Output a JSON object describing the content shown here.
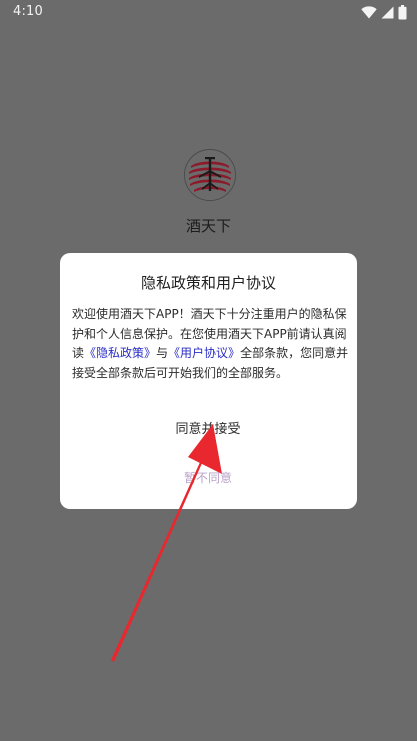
{
  "status_bar": {
    "time": "4:10",
    "icons": [
      "wifi-icon",
      "signal-icon",
      "battery-icon"
    ]
  },
  "app": {
    "name": "酒天下",
    "logo_icon": "jiutianxia-logo-icon"
  },
  "dialog": {
    "title": "隐私政策和用户协议",
    "body": {
      "text_before": "欢迎使用酒天下APP！酒天下十分注重用户的隐私保护和个人信息保护。在您使用酒天下APP前请认真阅读",
      "privacy_link": "《隐私政策》",
      "and_text": "与",
      "agreement_link": "《用户协议》",
      "text_after": "全部条款，您同意并接受全部条款后可开始我们的全部服务。"
    },
    "agree_label": "同意并接受",
    "disagree_label": "暂不同意"
  },
  "colors": {
    "overlay": "#6b6b6b",
    "link": "#2a2ec4",
    "disagree_text": "#b9a2c8",
    "logo_red": "#8b1a2b",
    "annotation_arrow": "#e8282e"
  }
}
